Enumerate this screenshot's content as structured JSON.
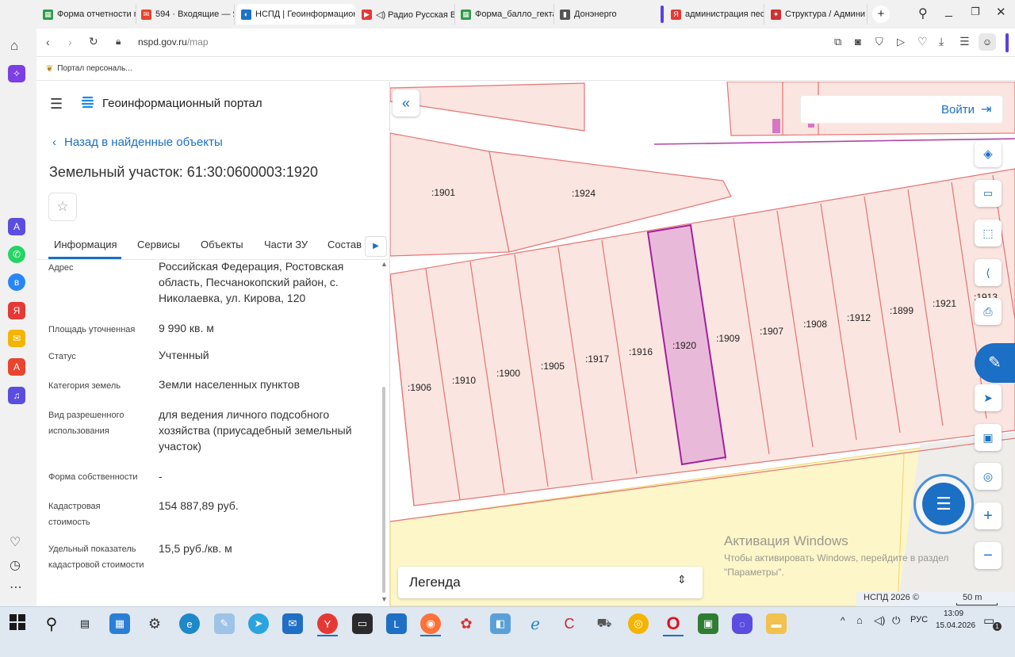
{
  "browser": {
    "tabs": [
      {
        "label": "Форма отчетности п",
        "color": "#2e9c4a",
        "glyph": "▦"
      },
      {
        "label": "594 · Входящие — Я",
        "color": "#e8442e",
        "glyph": "✉"
      },
      {
        "label": "НСПД | Геоинформацион",
        "color": "#1b73c6",
        "glyph": "◐"
      },
      {
        "label": "◁) Радио Русская Во",
        "color": "#e53935",
        "glyph": "▶"
      },
      {
        "label": "Форма_балло_гекта",
        "color": "#2e9c4a",
        "glyph": "▦"
      },
      {
        "label": "Донэнерго",
        "color": "#555555",
        "glyph": "▮"
      },
      {
        "label": "администрация пес",
        "color": "#e53935",
        "glyph": "Я"
      },
      {
        "label": "Структура / Админи",
        "color": "#d32f2f",
        "glyph": "✦"
      }
    ],
    "url_domain": "nspd.gov.ru",
    "url_path": "/map",
    "bookmark": "Портал персональ..."
  },
  "portal": {
    "title": "Геоинформационный портал",
    "back_link": "Назад в найденные объекты",
    "object_title": "Земельный участок: 61:30:0600003:1920",
    "tabs": [
      "Информация",
      "Сервисы",
      "Объекты",
      "Части ЗУ",
      "Состав"
    ],
    "active_tab": "Информация",
    "fields": [
      {
        "label": "Адрес",
        "value": "Российская Федерация, Ростовская область, Песчанокопский район, с. Николаевка, ул. Кирова, 120"
      },
      {
        "label": "Площадь уточненная",
        "value": "9 990 кв. м"
      },
      {
        "label": "Статус",
        "value": "Учтенный"
      },
      {
        "label": "Категория земель",
        "value": "Земли населенных пунктов"
      },
      {
        "label": "Вид разрешенного использования",
        "value": "для ведения личного подсобного хозяйства (приусадебный земельный участок)"
      },
      {
        "label": "Форма собственности",
        "value": "-"
      },
      {
        "label": "Кадастровая стоимость",
        "value": "154 887,89 руб."
      },
      {
        "label": "Удельный показатель кадастровой стоимости",
        "value": "15,5 руб./кв. м"
      }
    ]
  },
  "map": {
    "login_label": "Войти",
    "legend_label": "Легенда",
    "parcels_top": [
      ":1901",
      ":1924"
    ],
    "parcels_row": [
      ":1906",
      ":1910",
      ":1900",
      ":1905",
      ":1917",
      ":1916",
      ":1920",
      ":1909",
      ":1907",
      ":1908",
      ":1912",
      ":1899",
      ":1921",
      ":1913"
    ],
    "selected_parcel": ":1920",
    "watermark_title": "Активация Windows",
    "watermark_text": "Чтобы активировать Windows, перейдите в раздел \"Параметры\".",
    "copyright": "НСПД 2026 ©",
    "scale": "50 m"
  },
  "taskbar": {
    "lang": "РУС",
    "time": "13:09",
    "date": "15.04.2026",
    "notif_count": "1"
  }
}
